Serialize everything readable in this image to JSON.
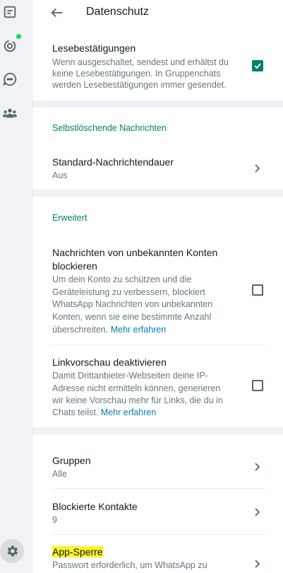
{
  "header": {
    "title": "Datenschutz"
  },
  "read_receipts": {
    "title": "Lesebestätigungen",
    "description_lines": [
      "Wenn ausgeschaltet, sendest und erhältst du",
      "keine Lesebestätigungen. In Gruppenchats",
      "werden Lesebestätigungen immer gesendet."
    ],
    "checked": true
  },
  "disappearing": {
    "section_title": "Selbstlöschende Nachrichten",
    "title": "Standard-Nachrichtendauer",
    "value": "Aus"
  },
  "advanced": {
    "section_title": "Erweitert",
    "block_unknown": {
      "title_lines": [
        "Nachrichten von unbekannten Konten",
        "blockieren"
      ],
      "description_lines": [
        "Um dein Konto zu schützen und die",
        "Geräteleistung zu verbessern, blockiert",
        "WhatsApp Nachrichten von unbekannten",
        "Konten, wenn sie eine bestimmte Anzahl",
        "überschreiten."
      ],
      "link": "Mehr erfahren",
      "checked": false
    },
    "link_preview": {
      "title": "Linkvorschau deaktivieren",
      "description_lines": [
        "Damit Drittanbieter-Webseiten deine IP-",
        "Adresse nicht ermitteln können, generieren",
        "wir keine Vorschau mehr für Links, die du in",
        "Chats teilst."
      ],
      "link": "Mehr erfahren",
      "checked": false
    }
  },
  "groups": {
    "title": "Gruppen",
    "value": "Alle"
  },
  "blocked": {
    "title": "Blockierte Kontakte",
    "value": "9"
  },
  "app_lock": {
    "title": "App-Sperre",
    "description": "Passwort erforderlich, um WhatsApp zu",
    "highlight_color": "#fdf32a"
  },
  "rail": {
    "icons": [
      "chats-icon",
      "status-icon",
      "channels-icon",
      "communities-icon",
      "settings-icon"
    ],
    "status_dot_color": "#25d366"
  }
}
